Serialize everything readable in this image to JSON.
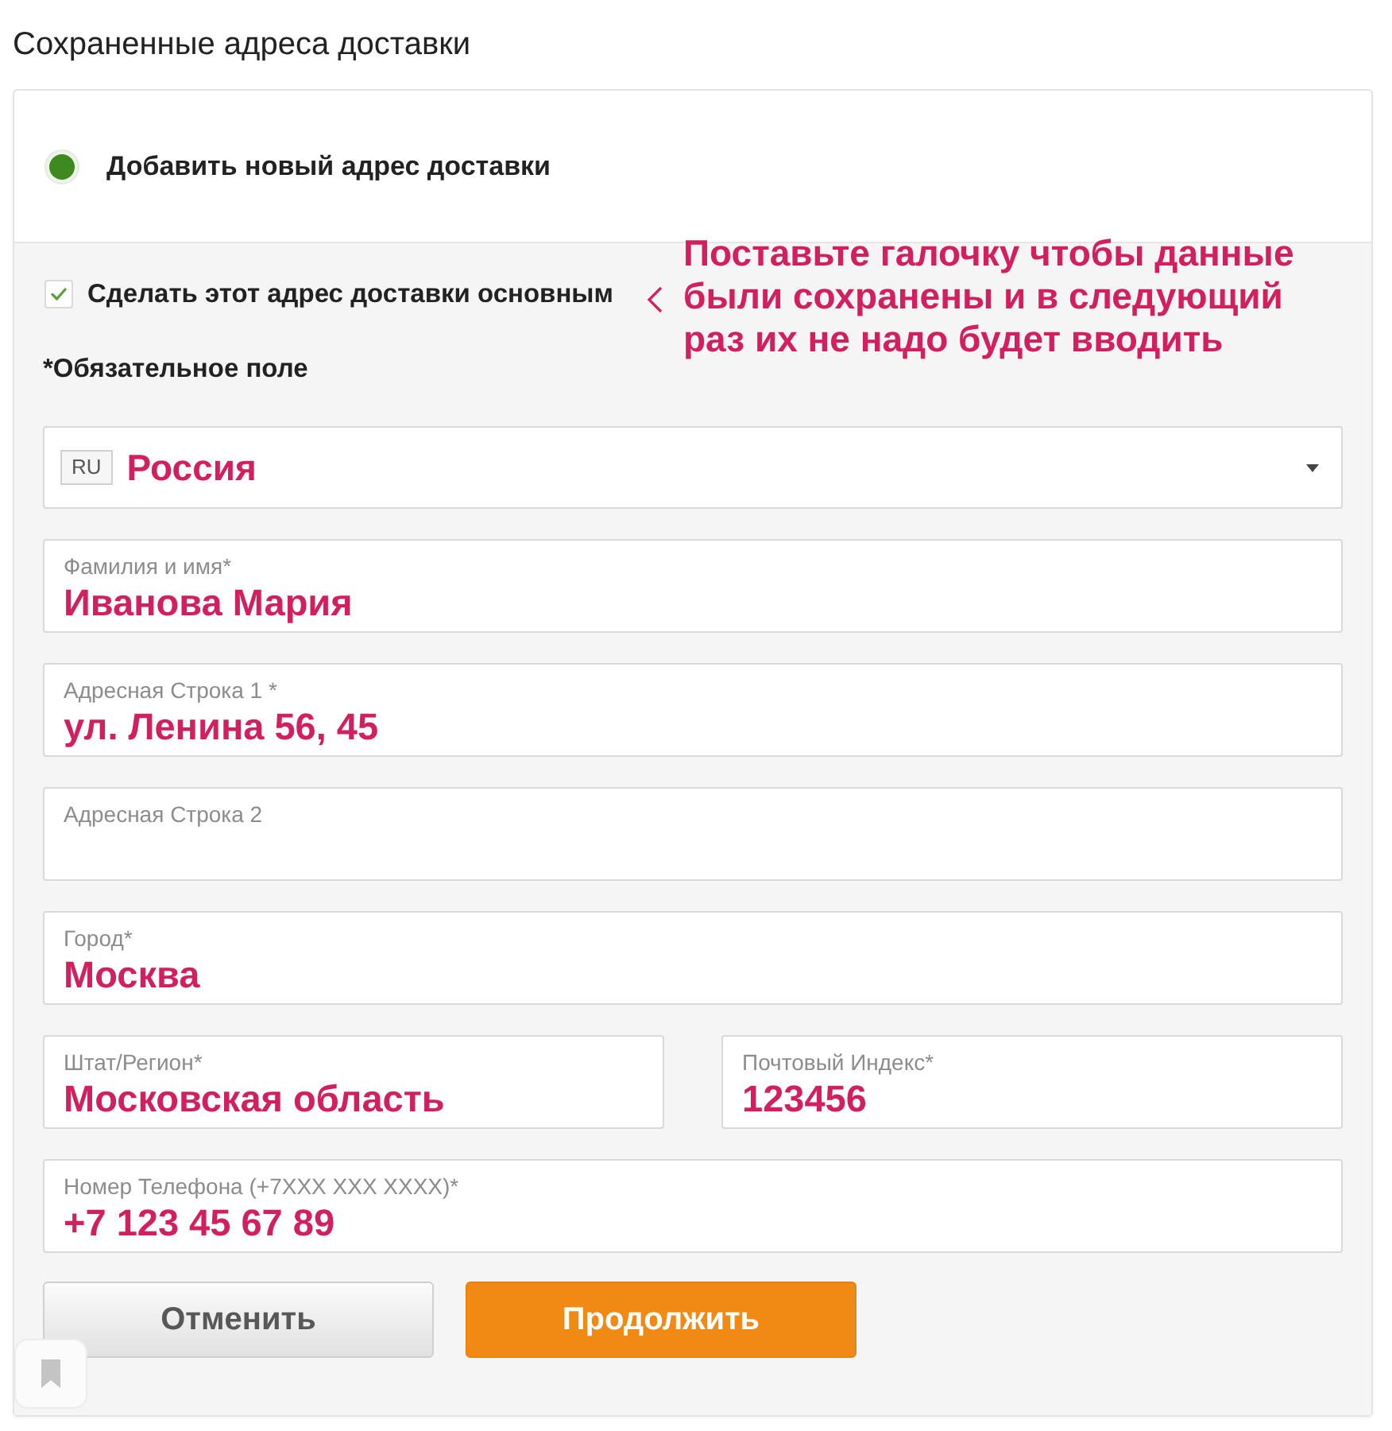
{
  "title": "Сохраненные адреса доставки",
  "address_option": {
    "label": "Добавить новый адрес доставки",
    "selected": true
  },
  "default_checkbox": {
    "label": "Сделать этот адрес доставки основным",
    "checked": true
  },
  "annotation": {
    "lines": [
      "Поставьте галочку чтобы данные",
      "были сохранены и в следующий",
      "раз их не надо будет вводить"
    ]
  },
  "required_note": "*Обязательное поле",
  "form_rows": [
    [
      {
        "kind": "select",
        "badge": "RU",
        "value": "Россия"
      }
    ],
    [
      {
        "kind": "text",
        "label": "Фамилия и имя*",
        "value": "Иванова Мария"
      }
    ],
    [
      {
        "kind": "text",
        "label": "Адресная Строка 1 *",
        "value": "ул. Ленина 56, 45"
      }
    ],
    [
      {
        "kind": "text",
        "label": "Адресная Строка 2"
      }
    ],
    [
      {
        "kind": "text",
        "label": "Город*",
        "value": "Москва"
      }
    ],
    [
      {
        "kind": "text",
        "label": "Штат/Регион*",
        "value": "Московская область"
      },
      {
        "kind": "text",
        "label": "Почтовый Индекс*",
        "value": "123456"
      }
    ],
    [
      {
        "kind": "text",
        "label": "Номер Телефона (+7XXX XXX XXXX)*",
        "value": "+7 123 45 67 89"
      }
    ]
  ],
  "buttons": [
    {
      "kind": "secondary",
      "label": "Отменить"
    },
    {
      "kind": "primary",
      "label": "Продолжить"
    }
  ]
}
